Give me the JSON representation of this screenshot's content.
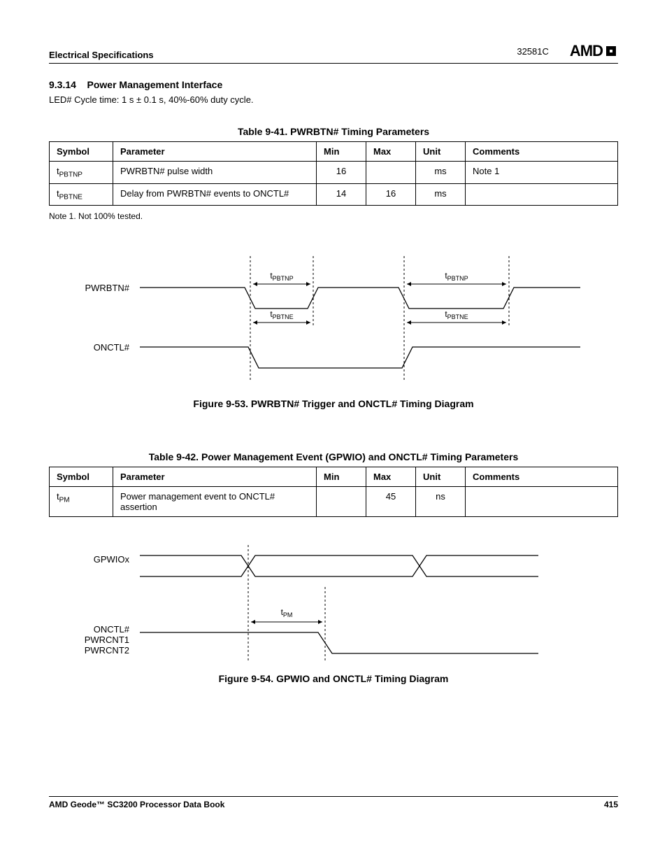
{
  "header": {
    "left": "Electrical Specifications",
    "docnum": "32581C",
    "brand": "AMD"
  },
  "section": {
    "number": "9.3.14",
    "title": "Power Management Interface",
    "led_text": "LED# Cycle time: 1 s ± 0.1 s, 40%-60% duty cycle."
  },
  "table41": {
    "caption": "Table 9-41.  PWRBTN# Timing Parameters",
    "headers": {
      "sym": "Symbol",
      "param": "Parameter",
      "min": "Min",
      "max": "Max",
      "unit": "Unit",
      "com": "Comments"
    },
    "rows": [
      {
        "sym_base": "t",
        "sym_sub": "PBTNP",
        "param": "PWRBTN# pulse width",
        "min": "16",
        "max": "",
        "unit": "ms",
        "com": "Note 1"
      },
      {
        "sym_base": "t",
        "sym_sub": "PBTNE",
        "param": "Delay from PWRBTN# events to ONCTL#",
        "min": "14",
        "max": "16",
        "unit": "ms",
        "com": ""
      }
    ],
    "note": "Note 1.   Not 100% tested."
  },
  "figure53": {
    "caption": "Figure 9-53.  PWRBTN# Trigger and ONCTL# Timing Diagram",
    "labels": {
      "pwrbtn": "PWRBTN#",
      "onctl": "ONCTL#",
      "tp_base": "t",
      "tp_sub": "PBTNP",
      "te_base": "t",
      "te_sub": "PBTNE"
    }
  },
  "table42": {
    "caption": "Table 9-42.  Power Management Event (GPWIO) and ONCTL# Timing Parameters",
    "headers": {
      "sym": "Symbol",
      "param": "Parameter",
      "min": "Min",
      "max": "Max",
      "unit": "Unit",
      "com": "Comments"
    },
    "rows": [
      {
        "sym_base": "t",
        "sym_sub": "PM",
        "param": "Power management event to ONCTL# assertion",
        "min": "",
        "max": "45",
        "unit": "ns",
        "com": ""
      }
    ]
  },
  "figure54": {
    "caption": "Figure 9-54.  GPWIO and ONCTL# Timing Diagram",
    "labels": {
      "gpwiox": "GPWIOx",
      "onctl": "ONCTL#",
      "pwrcnt1": "PWRCNT1",
      "pwrcnt2": "PWRCNT2",
      "tpm_base": "t",
      "tpm_sub": "PM"
    }
  },
  "footer": {
    "left": "AMD Geode™ SC3200 Processor Data Book",
    "right": "415"
  },
  "chart_data": [
    {
      "type": "table",
      "title": "PWRBTN# Timing Parameters",
      "columns": [
        "Symbol",
        "Parameter",
        "Min",
        "Max",
        "Unit",
        "Comments"
      ],
      "rows": [
        [
          "t_PBTNP",
          "PWRBTN# pulse width",
          16,
          null,
          "ms",
          "Note 1"
        ],
        [
          "t_PBTNE",
          "Delay from PWRBTN# events to ONCTL#",
          14,
          16,
          "ms",
          ""
        ]
      ]
    },
    {
      "type": "table",
      "title": "Power Management Event (GPWIO) and ONCTL# Timing Parameters",
      "columns": [
        "Symbol",
        "Parameter",
        "Min",
        "Max",
        "Unit",
        "Comments"
      ],
      "rows": [
        [
          "t_PM",
          "Power management event to ONCTL# assertion",
          null,
          45,
          "ns",
          ""
        ]
      ]
    }
  ]
}
